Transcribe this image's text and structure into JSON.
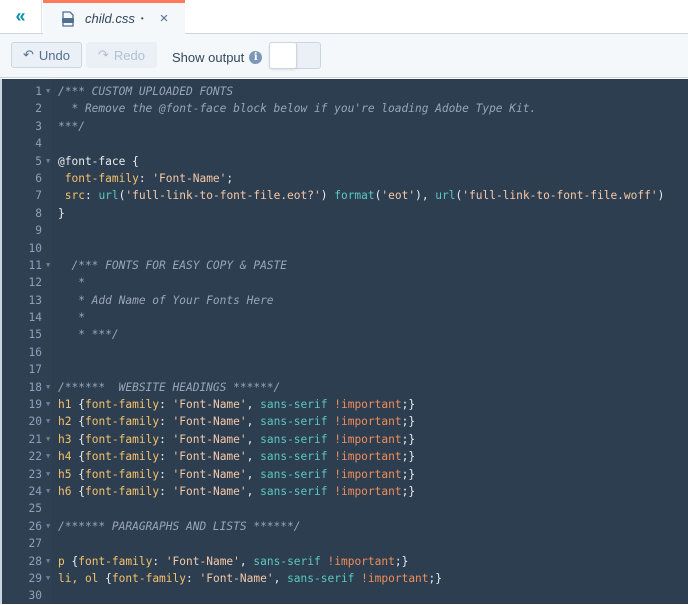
{
  "tabbar": {
    "collapse_icon": "double-chevron-left-icon",
    "tab": {
      "filename": "child.css",
      "unsaved_indicator": "•",
      "close_icon": "×",
      "file_icon": "css-file-icon"
    }
  },
  "toolbar": {
    "undo_label": "Undo",
    "redo_label": "Redo",
    "show_output_label": "Show output",
    "info_icon": "i",
    "toggle_on": false
  },
  "colors": {
    "accent": "#ff7a59",
    "editor_bg": "#2d3e50",
    "comment": "#97a7b8",
    "property": "#f5c26b",
    "string": "#f5c8a8",
    "function": "#5bc8c0",
    "important": "#f08d5a"
  },
  "editor": {
    "lines": [
      {
        "n": "1",
        "fold": true,
        "tokens": [
          [
            "c-comment",
            "/*** CUSTOM UPLOADED FONTS"
          ]
        ]
      },
      {
        "n": "2",
        "fold": false,
        "tokens": [
          [
            "c-comment",
            "  * Remove the @font-face block below if you're loading Adobe Type Kit."
          ]
        ]
      },
      {
        "n": "3",
        "fold": false,
        "tokens": [
          [
            "c-comment",
            "***/"
          ]
        ]
      },
      {
        "n": "4",
        "fold": false,
        "tokens": []
      },
      {
        "n": "5",
        "fold": true,
        "tokens": [
          [
            "c-punc",
            "@font-face {"
          ]
        ]
      },
      {
        "n": "6",
        "fold": false,
        "tokens": [
          [
            "c-prop",
            " font-family"
          ],
          [
            "c-punc",
            ": "
          ],
          [
            "c-str",
            "'Font-Name'"
          ],
          [
            "c-punc",
            ";"
          ]
        ]
      },
      {
        "n": "7",
        "fold": false,
        "tokens": [
          [
            "c-prop",
            " src"
          ],
          [
            "c-punc",
            ": "
          ],
          [
            "c-fn",
            "url"
          ],
          [
            "c-punc",
            "("
          ],
          [
            "c-str",
            "'full-link-to-font-file.eot?'"
          ],
          [
            "c-punc",
            ") "
          ],
          [
            "c-fn",
            "format"
          ],
          [
            "c-punc",
            "("
          ],
          [
            "c-str",
            "'eot'"
          ],
          [
            "c-punc",
            "), "
          ],
          [
            "c-fn",
            "url"
          ],
          [
            "c-punc",
            "("
          ],
          [
            "c-str",
            "'full-link-to-font-file.woff'"
          ],
          [
            "c-punc",
            ")"
          ]
        ]
      },
      {
        "n": "8",
        "fold": false,
        "tokens": [
          [
            "c-punc",
            "}"
          ]
        ]
      },
      {
        "n": "9",
        "fold": false,
        "tokens": []
      },
      {
        "n": "10",
        "fold": false,
        "tokens": []
      },
      {
        "n": "11",
        "fold": true,
        "tokens": [
          [
            "c-comment",
            "  /*** FONTS FOR EASY COPY & PASTE"
          ]
        ]
      },
      {
        "n": "12",
        "fold": false,
        "tokens": [
          [
            "c-comment",
            "   *"
          ]
        ]
      },
      {
        "n": "13",
        "fold": false,
        "tokens": [
          [
            "c-comment",
            "   * Add Name of Your Fonts Here"
          ]
        ]
      },
      {
        "n": "14",
        "fold": false,
        "tokens": [
          [
            "c-comment",
            "   *"
          ]
        ]
      },
      {
        "n": "15",
        "fold": false,
        "tokens": [
          [
            "c-comment",
            "   * ***/"
          ]
        ]
      },
      {
        "n": "16",
        "fold": false,
        "tokens": []
      },
      {
        "n": "17",
        "fold": false,
        "tokens": []
      },
      {
        "n": "18",
        "fold": true,
        "tokens": [
          [
            "c-comment",
            "/******  WEBSITE HEADINGS ******/"
          ]
        ]
      },
      {
        "n": "19",
        "fold": true,
        "tokens": [
          [
            "c-sel",
            "h1"
          ],
          [
            "c-punc",
            " {"
          ],
          [
            "c-prop",
            "font-family"
          ],
          [
            "c-punc",
            ": "
          ],
          [
            "c-str",
            "'Font-Name'"
          ],
          [
            "c-punc",
            ", "
          ],
          [
            "c-fn",
            "sans-serif"
          ],
          [
            "c-punc",
            " "
          ],
          [
            "c-imp",
            "!important"
          ],
          [
            "c-punc",
            ";}"
          ]
        ]
      },
      {
        "n": "20",
        "fold": true,
        "tokens": [
          [
            "c-sel",
            "h2"
          ],
          [
            "c-punc",
            " {"
          ],
          [
            "c-prop",
            "font-family"
          ],
          [
            "c-punc",
            ": "
          ],
          [
            "c-str",
            "'Font-Name'"
          ],
          [
            "c-punc",
            ", "
          ],
          [
            "c-fn",
            "sans-serif"
          ],
          [
            "c-punc",
            " "
          ],
          [
            "c-imp",
            "!important"
          ],
          [
            "c-punc",
            ";}"
          ]
        ]
      },
      {
        "n": "21",
        "fold": true,
        "tokens": [
          [
            "c-sel",
            "h3"
          ],
          [
            "c-punc",
            " {"
          ],
          [
            "c-prop",
            "font-family"
          ],
          [
            "c-punc",
            ": "
          ],
          [
            "c-str",
            "'Font-Name'"
          ],
          [
            "c-punc",
            ", "
          ],
          [
            "c-fn",
            "sans-serif"
          ],
          [
            "c-punc",
            " "
          ],
          [
            "c-imp",
            "!important"
          ],
          [
            "c-punc",
            ";}"
          ]
        ]
      },
      {
        "n": "22",
        "fold": true,
        "tokens": [
          [
            "c-sel",
            "h4"
          ],
          [
            "c-punc",
            " {"
          ],
          [
            "c-prop",
            "font-family"
          ],
          [
            "c-punc",
            ": "
          ],
          [
            "c-str",
            "'Font-Name'"
          ],
          [
            "c-punc",
            ", "
          ],
          [
            "c-fn",
            "sans-serif"
          ],
          [
            "c-punc",
            " "
          ],
          [
            "c-imp",
            "!important"
          ],
          [
            "c-punc",
            ";}"
          ]
        ]
      },
      {
        "n": "23",
        "fold": true,
        "tokens": [
          [
            "c-sel",
            "h5"
          ],
          [
            "c-punc",
            " {"
          ],
          [
            "c-prop",
            "font-family"
          ],
          [
            "c-punc",
            ": "
          ],
          [
            "c-str",
            "'Font-Name'"
          ],
          [
            "c-punc",
            ", "
          ],
          [
            "c-fn",
            "sans-serif"
          ],
          [
            "c-punc",
            " "
          ],
          [
            "c-imp",
            "!important"
          ],
          [
            "c-punc",
            ";}"
          ]
        ]
      },
      {
        "n": "24",
        "fold": true,
        "tokens": [
          [
            "c-sel",
            "h6"
          ],
          [
            "c-punc",
            " {"
          ],
          [
            "c-prop",
            "font-family"
          ],
          [
            "c-punc",
            ": "
          ],
          [
            "c-str",
            "'Font-Name'"
          ],
          [
            "c-punc",
            ", "
          ],
          [
            "c-fn",
            "sans-serif"
          ],
          [
            "c-punc",
            " "
          ],
          [
            "c-imp",
            "!important"
          ],
          [
            "c-punc",
            ";}"
          ]
        ]
      },
      {
        "n": "25",
        "fold": false,
        "tokens": []
      },
      {
        "n": "26",
        "fold": true,
        "tokens": [
          [
            "c-comment",
            "/****** PARAGRAPHS AND LISTS ******/"
          ]
        ]
      },
      {
        "n": "27",
        "fold": false,
        "tokens": []
      },
      {
        "n": "28",
        "fold": true,
        "tokens": [
          [
            "c-sel",
            "p"
          ],
          [
            "c-punc",
            " {"
          ],
          [
            "c-prop",
            "font-family"
          ],
          [
            "c-punc",
            ": "
          ],
          [
            "c-str",
            "'Font-Name'"
          ],
          [
            "c-punc",
            ", "
          ],
          [
            "c-fn",
            "sans-serif"
          ],
          [
            "c-punc",
            " "
          ],
          [
            "c-imp",
            "!important"
          ],
          [
            "c-punc",
            ";}"
          ]
        ]
      },
      {
        "n": "29",
        "fold": true,
        "tokens": [
          [
            "c-sel",
            "li, ol"
          ],
          [
            "c-punc",
            " {"
          ],
          [
            "c-prop",
            "font-family"
          ],
          [
            "c-punc",
            ": "
          ],
          [
            "c-str",
            "'Font-Name'"
          ],
          [
            "c-punc",
            ", "
          ],
          [
            "c-fn",
            "sans-serif"
          ],
          [
            "c-punc",
            " "
          ],
          [
            "c-imp",
            "!important"
          ],
          [
            "c-punc",
            ";}"
          ]
        ]
      },
      {
        "n": "30",
        "fold": false,
        "tokens": []
      }
    ]
  }
}
